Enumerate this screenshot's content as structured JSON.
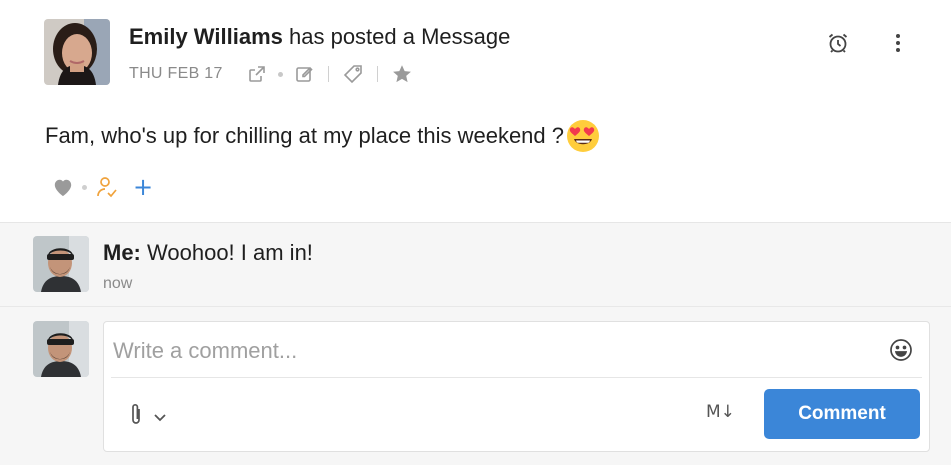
{
  "post": {
    "author": "Emily Williams",
    "action_text": "has posted a Message",
    "date": "THU FEB 17",
    "message": "Fam, who's up for chilling at my place this weekend ?",
    "emoji": "smiling-face-with-heart-eyes",
    "icons": {
      "open_external": "external-link-icon",
      "edit": "edit-icon",
      "tag": "tag-icon",
      "star": "star-icon",
      "alarm": "alarm-clock-icon",
      "more": "more-vertical-icon",
      "like": "heart-icon",
      "followers": "user-check-icon",
      "add_reaction": "plus-icon"
    },
    "add_label": "+"
  },
  "comments": [
    {
      "author": "Me:",
      "text": "Woohoo! I am in!",
      "time": "now"
    }
  ],
  "composer": {
    "placeholder": "Write a comment...",
    "markdown_label": "M↓",
    "submit_label": "Comment"
  },
  "colors": {
    "accent": "#3b86d8",
    "follower_icon": "#f0a23b",
    "muted": "#8a8a8a",
    "comments_bg": "#f6f6f6"
  }
}
